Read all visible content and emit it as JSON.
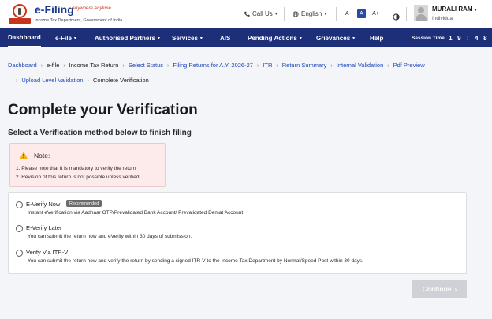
{
  "header": {
    "logo_title": "e-Filing",
    "logo_tagline": "Anywhere Anytime",
    "logo_subtitle": "Income Tax Department, Government of India",
    "call_us": "Call Us",
    "language": "English",
    "font_decrease": "A-",
    "font_default": "A",
    "font_increase": "A+",
    "user_name": "MURALI RAM",
    "user_role": "Individual"
  },
  "nav": {
    "items": [
      {
        "label": "Dashboard",
        "dropdown": false
      },
      {
        "label": "e-File",
        "dropdown": true
      },
      {
        "label": "Authorised Partners",
        "dropdown": true
      },
      {
        "label": "Services",
        "dropdown": true
      },
      {
        "label": "AIS",
        "dropdown": false
      },
      {
        "label": "Pending Actions",
        "dropdown": true
      },
      {
        "label": "Grievances",
        "dropdown": true
      },
      {
        "label": "Help",
        "dropdown": false
      }
    ],
    "session_label": "Session Time",
    "session_digits": [
      "1",
      "9",
      ":",
      "4",
      "8"
    ]
  },
  "breadcrumb": [
    "Dashboard",
    "e-file",
    "Income Tax Return",
    "Select Status",
    "Filing Returns for A.Y. 2026-27",
    "ITR",
    "Return Summary",
    "Internal Validation",
    "Pdf Preview",
    "Upload Level Validation",
    "Complete Verification"
  ],
  "page": {
    "title": "Complete your Verification",
    "subtitle": "Select a Verification method below to finish filing"
  },
  "note": {
    "heading": "Note:",
    "line1": "1. Please note that it is mandatory to verify the return",
    "line2": "2. Revision of this return is not possible unless verified"
  },
  "options": [
    {
      "title": "E-Verify Now",
      "badge": "Recommended",
      "desc": "Instant eVerification via Aadhaar OTP/Prevalidated Bank Account/ Prevalidated Demat Account"
    },
    {
      "title": "E-Verify Later",
      "desc": "You can submit the return now and eVerify within 30 days of submission."
    },
    {
      "title": "Verify Via ITR-V",
      "desc": "You can submit the return now and verify the return by sending a signed ITR-V to the Income Tax Department by Normal/Speed Post within 30 days."
    }
  ],
  "continue_label": "Continue",
  "colors": {
    "nav_bg": "#1e2f7a",
    "link": "#1e47b8",
    "note_bg": "#fdeaea",
    "warning": "#f2b21b",
    "brand_red": "#c8351f"
  }
}
